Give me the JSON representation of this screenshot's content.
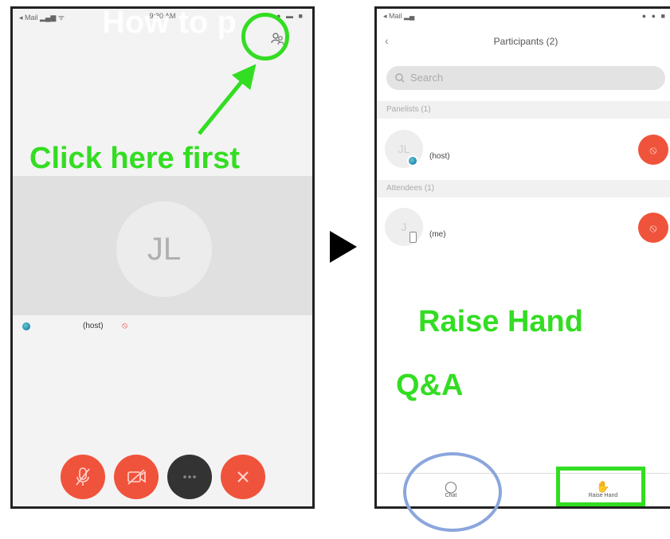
{
  "overlay_title": "How to p",
  "left_phone": {
    "status": {
      "carrier": "◂ Mail ▂▄▆ ᯤ",
      "time": "9:30 AM",
      "icons": "● ▬ ■"
    },
    "participants_icon": "people-icon",
    "avatar_initials": "JL",
    "host_label": "(host)",
    "controls": {
      "mic_icon": "mic-icon",
      "video_icon": "video-icon",
      "more_icon": "more-icon",
      "leave_icon": "close-icon"
    }
  },
  "right_phone": {
    "status": {
      "carrier": "◂ Mail ▂▄",
      "icons": "● ● ■"
    },
    "back_glyph": "‹",
    "title": "Particiؚpants (2)",
    "search_placeholder": "Search",
    "sections": {
      "panelists": "Panelists (1)",
      "attendees": "Attendees (1)"
    },
    "participants": [
      {
        "initials": "JL",
        "label": "(host)"
      },
      {
        "initials": "J",
        "label": "(me)"
      }
    ],
    "tabs": {
      "chat": "Chat",
      "raise_hand": "Raise Hand"
    }
  },
  "annotations": {
    "click_here": "Click here first",
    "raise_hand": "Raise Hand",
    "qa": "Q&A"
  },
  "colors": {
    "annotation_green": "#33dd22",
    "mic_red": "#f0533b",
    "chat_circle_blue": "#8aa6dc"
  }
}
